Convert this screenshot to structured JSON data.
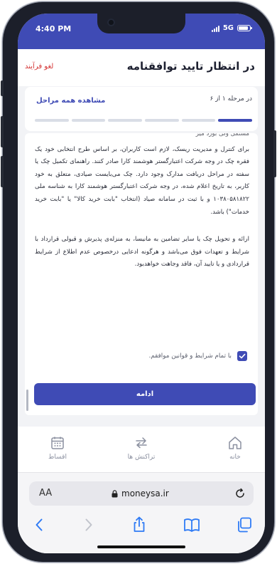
{
  "status_bar": {
    "time": "4:40 PM",
    "network": "5G"
  },
  "header": {
    "title": "در انتظار تایید توافقنامه",
    "cancel_label": "لغو فرآیند"
  },
  "steps": {
    "current_text": "در مرحله ۱ از ۶",
    "view_all_label": "مشاهده همه مراحل",
    "total": 6,
    "current": 1
  },
  "terms": {
    "cut_line": "مشتمل ولی بورد میر",
    "paragraph1": "برای کنترل و مدیریت ریسک، لازم است کاربران، بر اساس طرح انتخابی خود یک فقره چک در وجه شرکت اعتبارگستر هوشمند کارا صادر کنند. راهنمای تکمیل چک یا سفته در مراحل دریافت مدارک وجود دارد. چک می‌بایست صیادی، متعلق به خود کاربر، به تاریخ اعلام شده، در وجه شرکت اعتبارگستر هوشمند کارا به شناسه ملی ۱۰۳۸۰۵۸۱۸۲۲ و با ثبت در سامانه صیاد (انتخاب \"بابت خرید کالا\" یا \"بابت خرید خدمات\") باشد.",
    "paragraph2": "ارائه و تحویل چک یا سایر تضامین به مانیسا، به منزله‌ی پذیرش و قبولی قرارداد با شرایط و تعهدات فوق می‌باشد و هرگونه ادعایی درخصوص عدم اطلاع از شرایط قراردادی و یا تایید آن، فاقد وجاهت خواهدبود."
  },
  "agreement": {
    "label": "با تمام شرایط و قوانین موافقم.",
    "checked": true
  },
  "continue_label": "ادامه",
  "bottom_nav": {
    "home": "خانه",
    "transactions": "تراکنش ها",
    "installments": "اقساط"
  },
  "browser": {
    "aa_label": "AA",
    "url": "moneysa.ir"
  },
  "colors": {
    "primary": "#3f4bb5",
    "danger": "#d43535"
  }
}
